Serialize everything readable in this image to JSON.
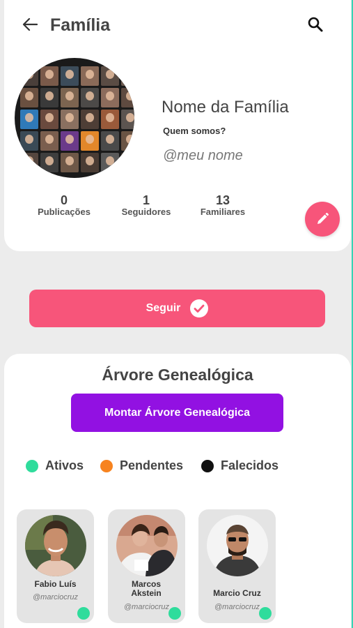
{
  "header": {
    "title": "Família",
    "back_icon": "arrow-left-icon",
    "search_icon": "search-icon"
  },
  "profile": {
    "name": "Nome da Família",
    "about": "Quem somos?",
    "handle": "@meu nome"
  },
  "stats": [
    {
      "value": "0",
      "label": "Publicações"
    },
    {
      "value": "1",
      "label": "Seguidores"
    },
    {
      "value": "13",
      "label": "Familiares"
    }
  ],
  "follow_button": {
    "label": "Seguir",
    "icon": "check-circle-icon"
  },
  "tree": {
    "title": "Árvore Genealógica",
    "build_button": "Montar Árvore Genealógica",
    "legend": [
      {
        "label": "Ativos",
        "color": "#2fdc9c"
      },
      {
        "label": "Pendentes",
        "color": "#f7831f"
      },
      {
        "label": "Falecidos",
        "color": "#111111"
      }
    ],
    "members": [
      {
        "name": "Fabio Luís",
        "username": "@marciocruz",
        "status": "Ativos"
      },
      {
        "name": "Marcos Akstein",
        "username": "@marciocruz",
        "status": "Ativos"
      },
      {
        "name": "Marcio Cruz",
        "username": "@marciocruz",
        "status": "Ativos"
      }
    ]
  },
  "colors": {
    "accent_pink": "#f7557a",
    "accent_purple": "#9211e2",
    "active_green": "#2fdc9c"
  }
}
